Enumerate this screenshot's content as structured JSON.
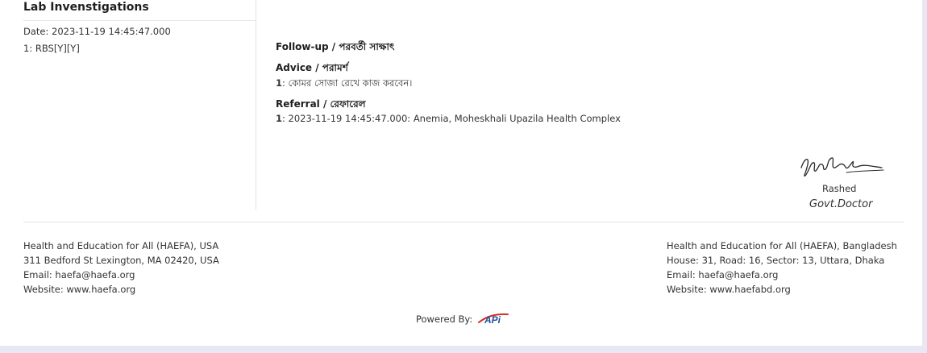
{
  "lab": {
    "title": "Lab Invenstigations",
    "date": "Date: 2023-11-19 14:45:47.000",
    "item": "1: RBS[Y][Y]"
  },
  "followup": {
    "heading": "Follow-up / পরবর্তী সাক্ষাৎ"
  },
  "advice": {
    "heading": "Advice / পরামর্শ",
    "num": "1",
    "text": ": কোমর সোজা রেখে কাজ করবেন।"
  },
  "referral": {
    "heading": "Referral / রেফারেল",
    "num": "1",
    "text": ": 2023-11-19 14:45:47.000: Anemia, Moheskhali Upazila Health Complex"
  },
  "doctor": {
    "name": "Rashed",
    "title": "Govt.Doctor"
  },
  "footer": {
    "usa": {
      "org": "Health and Education for All (HAEFA), USA",
      "address": "311 Bedford St Lexington, MA 02420, USA",
      "email": "Email: haefa@haefa.org",
      "website": "Website: www.haefa.org"
    },
    "bd": {
      "org": "Health and Education for All (HAEFA), Bangladesh",
      "address": "House: 31, Road: 16, Sector: 13, Uttara, Dhaka",
      "email": "Email: haefa@haefa.org",
      "website": "Website: www.haefabd.org"
    },
    "powered_by": "Powered By:",
    "logo_text": "APi"
  }
}
